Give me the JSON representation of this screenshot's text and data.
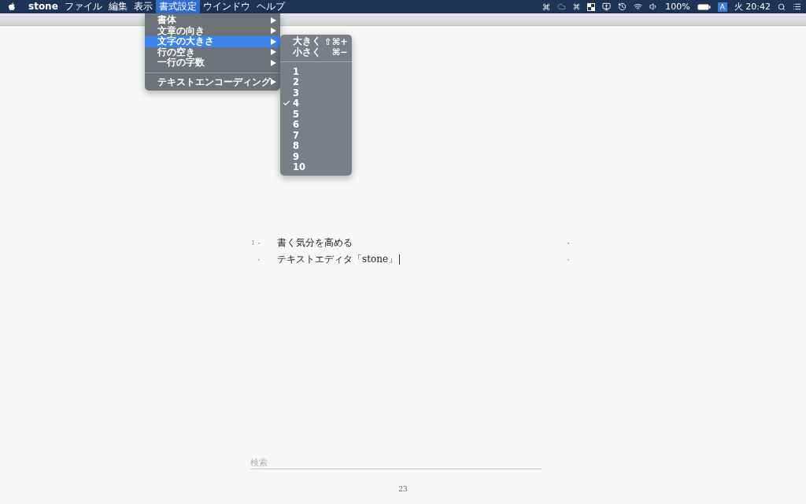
{
  "menubar": {
    "app_name": "stone",
    "menus": [
      {
        "label": "ファイル",
        "selected": false
      },
      {
        "label": "編集",
        "selected": false
      },
      {
        "label": "表示",
        "selected": false
      },
      {
        "label": "書式設定",
        "selected": true
      },
      {
        "label": "ウインドウ",
        "selected": false
      },
      {
        "label": "ヘルプ",
        "selected": false
      }
    ],
    "status": {
      "battery": "100%",
      "input_source": "A",
      "clock": "火 20:42"
    }
  },
  "format_menu": {
    "items": [
      {
        "kind": "item",
        "label": "書体",
        "selected": false
      },
      {
        "kind": "item",
        "label": "文章の向き",
        "selected": false
      },
      {
        "kind": "item",
        "label": "文字の大きさ",
        "selected": true
      },
      {
        "kind": "item",
        "label": "行の空き",
        "selected": false
      },
      {
        "kind": "item",
        "label": "一行の字数",
        "selected": false
      },
      {
        "kind": "separator"
      },
      {
        "kind": "item",
        "label": "テキストエンコーディング",
        "selected": false
      }
    ]
  },
  "size_submenu": {
    "items": [
      {
        "kind": "item",
        "label": "大きく",
        "shortcut": "⇧⌘+",
        "checked": false
      },
      {
        "kind": "item",
        "label": "小さく",
        "shortcut": "⌘−",
        "checked": false
      },
      {
        "kind": "separator"
      },
      {
        "kind": "item",
        "label": "1",
        "checked": false
      },
      {
        "kind": "item",
        "label": "2",
        "checked": false
      },
      {
        "kind": "item",
        "label": "3",
        "checked": false
      },
      {
        "kind": "item",
        "label": "4",
        "checked": true
      },
      {
        "kind": "item",
        "label": "5",
        "checked": false
      },
      {
        "kind": "item",
        "label": "6",
        "checked": false
      },
      {
        "kind": "item",
        "label": "7",
        "checked": false
      },
      {
        "kind": "item",
        "label": "8",
        "checked": false
      },
      {
        "kind": "item",
        "label": "9",
        "checked": false
      },
      {
        "kind": "item",
        "label": "10",
        "checked": false
      }
    ]
  },
  "document": {
    "lines": [
      {
        "number": "1",
        "text": "書く気分を高める",
        "cursor": false
      },
      {
        "text": "テキストエディタ「stone」",
        "cursor": true
      }
    ],
    "search": {
      "placeholder": "検索"
    },
    "page_number": "23"
  }
}
